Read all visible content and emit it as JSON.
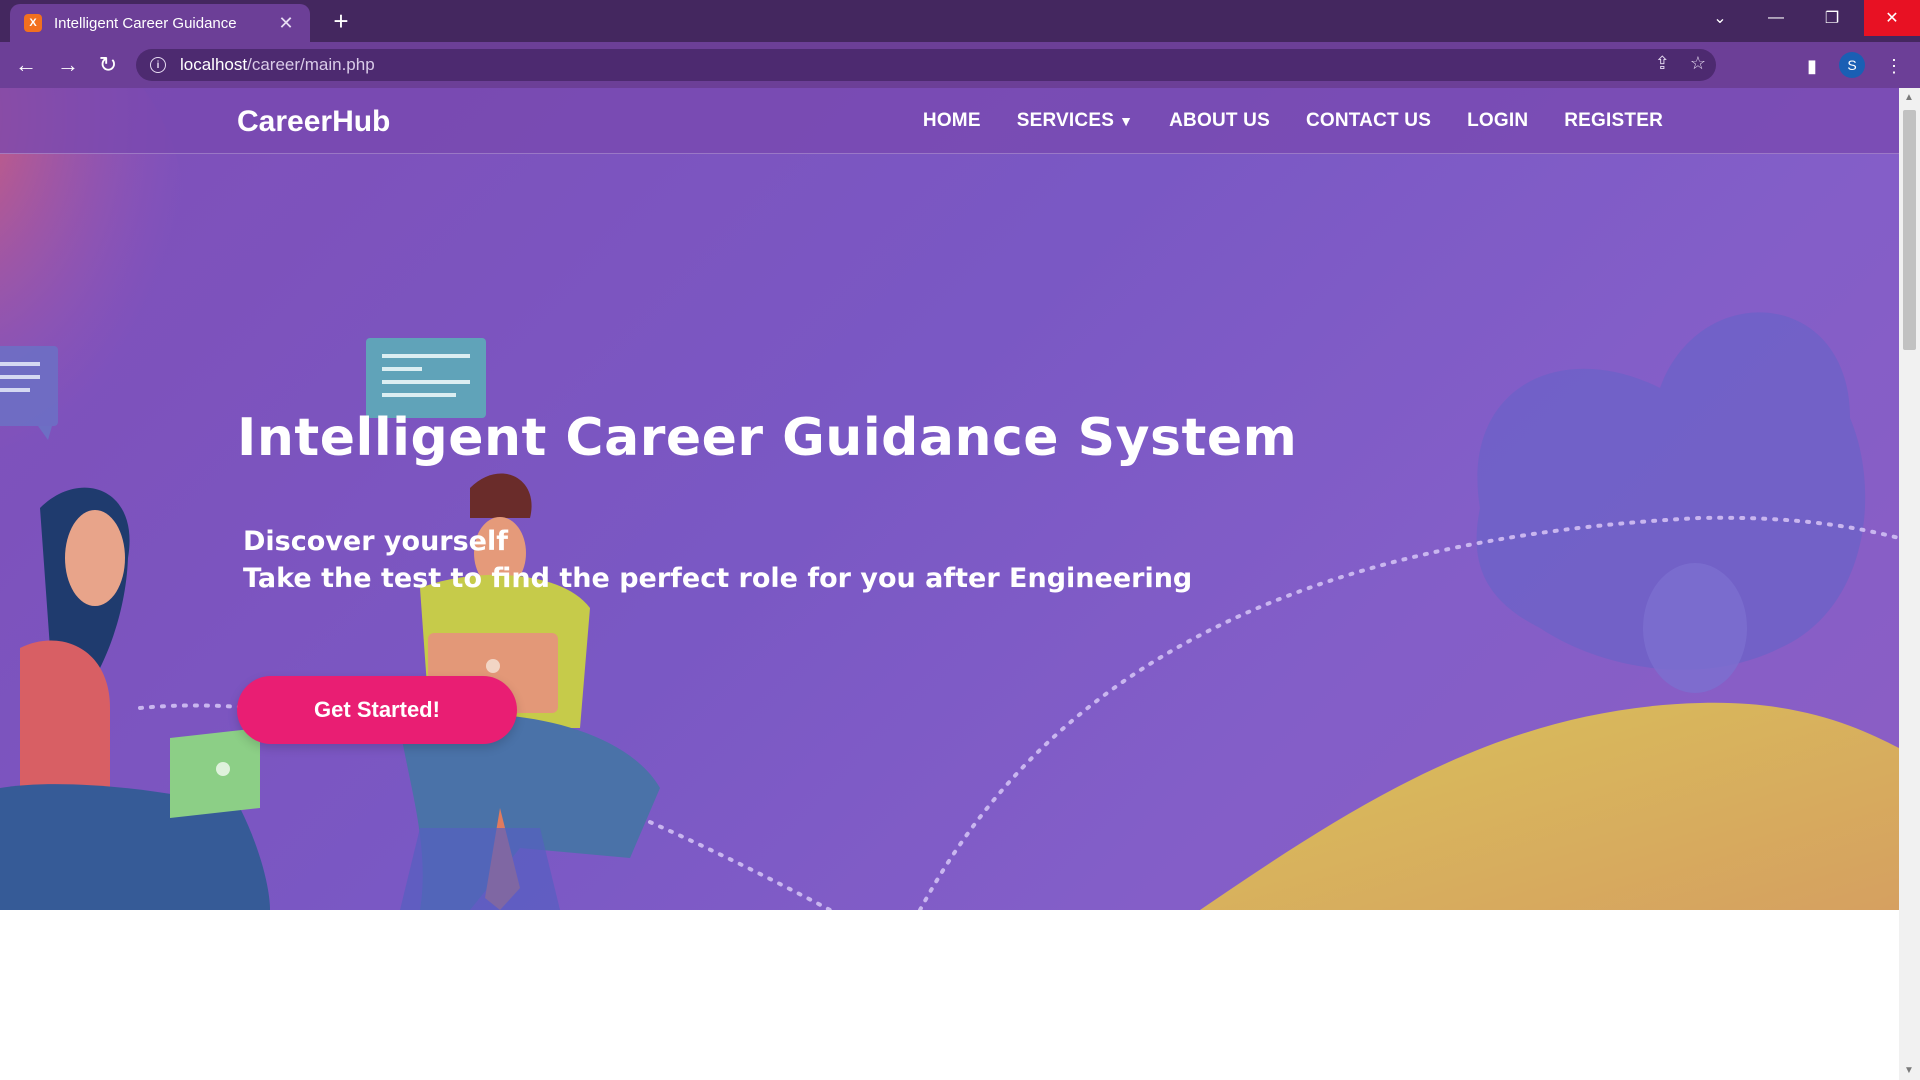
{
  "browser": {
    "tab_title": "Intelligent Career Guidance",
    "favicon": "X",
    "url_host": "localhost",
    "url_path": "/career/main.php",
    "profile_initial": "S"
  },
  "navbar": {
    "brand": "CareerHub",
    "items": [
      {
        "label": "HOME"
      },
      {
        "label": "SERVICES"
      },
      {
        "label": "ABOUT US"
      },
      {
        "label": "CONTACT US"
      },
      {
        "label": "LOGIN"
      },
      {
        "label": "REGISTER"
      }
    ]
  },
  "hero": {
    "title": "Intelligent Career Guidance System",
    "subtitle_line1": "Discover yourself",
    "subtitle_line2": "Take the test to find the perfect role for you after Engineering",
    "cta_label": "Get Started!"
  },
  "colors": {
    "hero_purple": "#7f4fb8",
    "cta_pink": "#e91e73",
    "chrome_purple": "#6c3f97"
  }
}
